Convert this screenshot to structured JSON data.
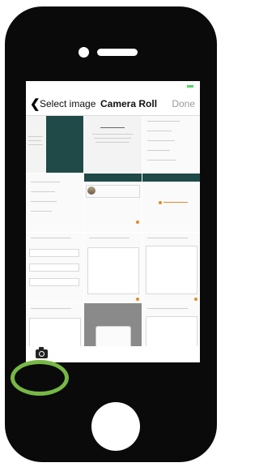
{
  "navbar": {
    "back_glyph": "❮",
    "left_label": "Select image",
    "title": "Camera Roll",
    "done_label": "Done"
  },
  "toolbar": {
    "camera_icon": "camera-icon"
  },
  "colors": {
    "accent_teal": "#1f4a48",
    "status_orange": "#e38b27",
    "highlight_ring": "#77b844",
    "battery": "#4cd964"
  }
}
